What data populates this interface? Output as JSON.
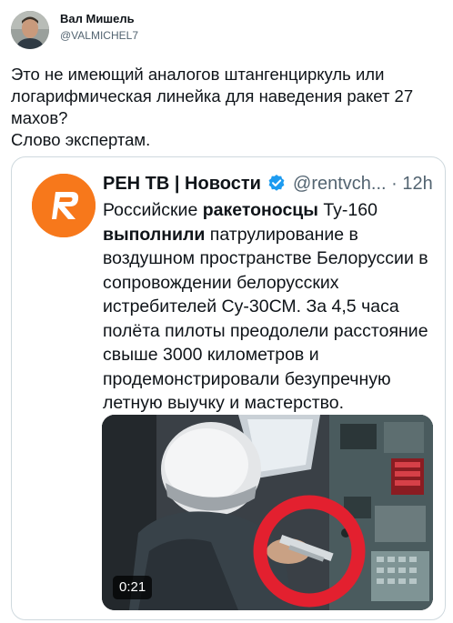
{
  "tweet": {
    "author_name": "Вал Мишель",
    "author_handle": "@VALMICHEL7",
    "text": "Это не имеющий аналогов штангенциркуль или логарифмическая линейка для наведения ракет 27 махов?\nСлово экспертам."
  },
  "quote": {
    "name": "РЕН ТВ | Новости",
    "handle": "@rentvch...",
    "separator": "·",
    "time": "12h",
    "body": {
      "p1": "Российские ",
      "b1": "ракетоносцы",
      "p2": " Ту-160 ",
      "b2": "выполнили",
      "p3": " патрулирование в воздушном пространстве Белоруссии в сопровождении белорусских истребителей Су-30СМ. За 4,5 часа полёта пилоты преодолели расстояние свыше 3000 километров и продемонстрировали безупречную летную выучку и мастерство."
    },
    "video": {
      "duration": "0:21"
    },
    "colors": {
      "brand": "#f7781b",
      "verified": "#1d9bf0",
      "highlight_circle": "#e3202f"
    }
  },
  "icons": [
    "verified-badge-icon",
    "ren-tv-logo-icon"
  ]
}
